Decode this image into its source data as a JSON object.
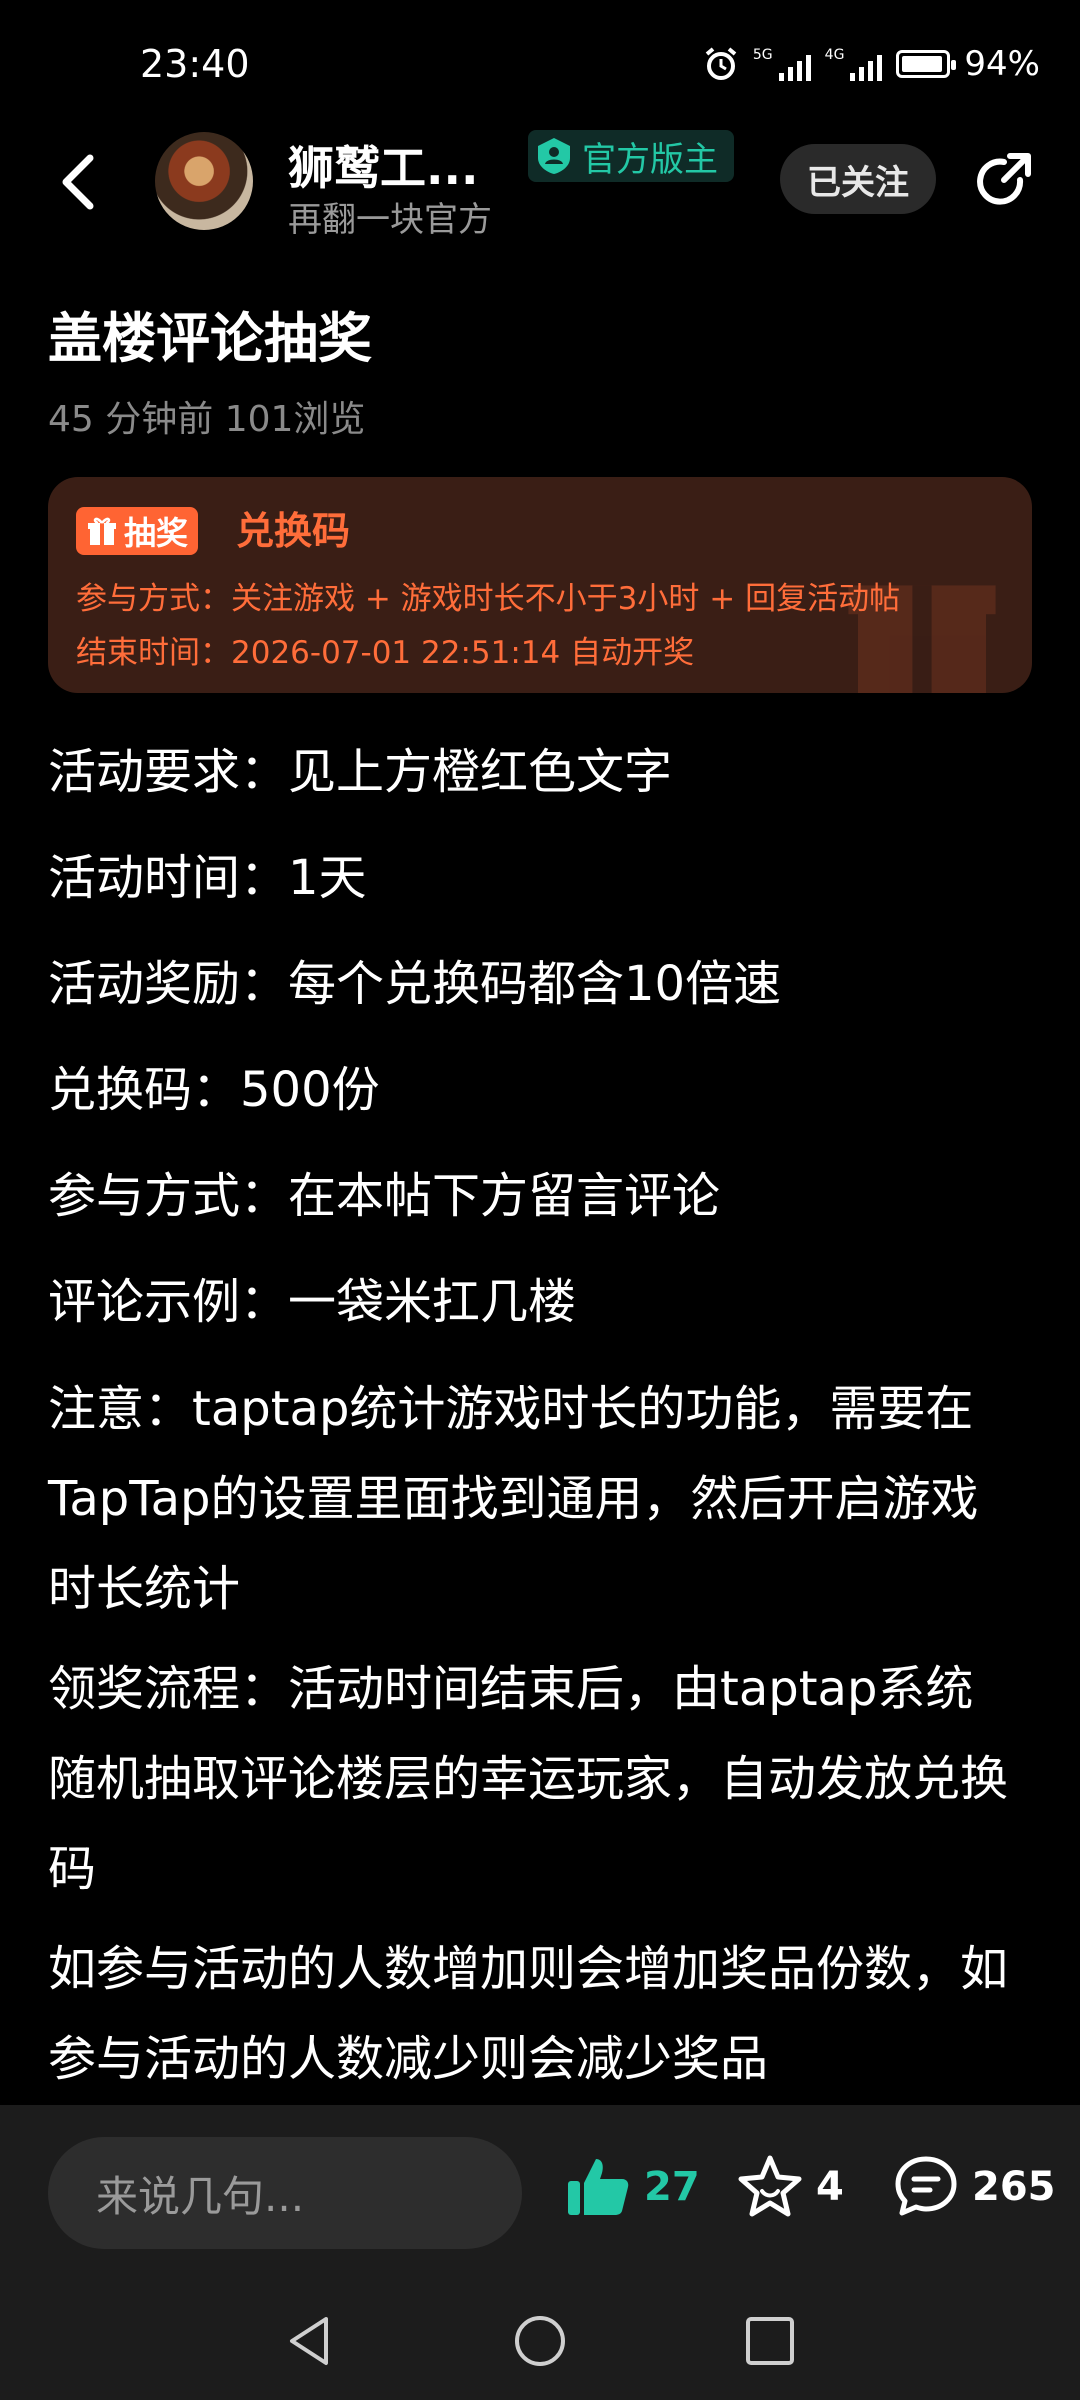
{
  "status_bar": {
    "time": "23:40",
    "battery": "94%",
    "battery_level": 0.94,
    "signal1": "5G",
    "signal2": "4G"
  },
  "header": {
    "author_name": "狮鹫工...",
    "author_subtitle": "再翻一块官方",
    "badge": "官方版主",
    "follow_label": "已关注"
  },
  "post": {
    "title": "盖楼评论抽奖",
    "meta": "45 分钟前  101浏览",
    "lottery": {
      "tag": "抽奖",
      "prize": "兑换码",
      "method": "参与方式：关注游戏 + 游戏时长不小于3小时 + 回复活动帖",
      "end_time": "结束时间：2026-07-01 22:51:14 自动开奖"
    },
    "lines": [
      "活动要求：见上方橙红色文字",
      "活动时间：1天",
      "活动奖励：每个兑换码都含10倍速",
      "兑换码：500份",
      "参与方式：在本帖下方留言评论",
      "评论示例：一袋米扛几楼",
      "注意：taptap统计游戏时长的功能，需要在TapTap的设置里面找到通用，然后开启游戏时长统计",
      "领奖流程：活动时间结束后，由taptap系统随机抽取评论楼层的幸运玩家，自动发放兑换码",
      "如参与活动的人数增加则会增加奖品份数，如参与活动的人数减少则会减少奖品"
    ]
  },
  "actions": {
    "comment_placeholder": "来说几句...",
    "like_count": "27",
    "favorite_count": "4",
    "comment_count": "265"
  },
  "colors": {
    "accent_green": "#23c8a6",
    "lottery_orange": "#ff6d3a",
    "lottery_bg": "#3a1e15"
  }
}
